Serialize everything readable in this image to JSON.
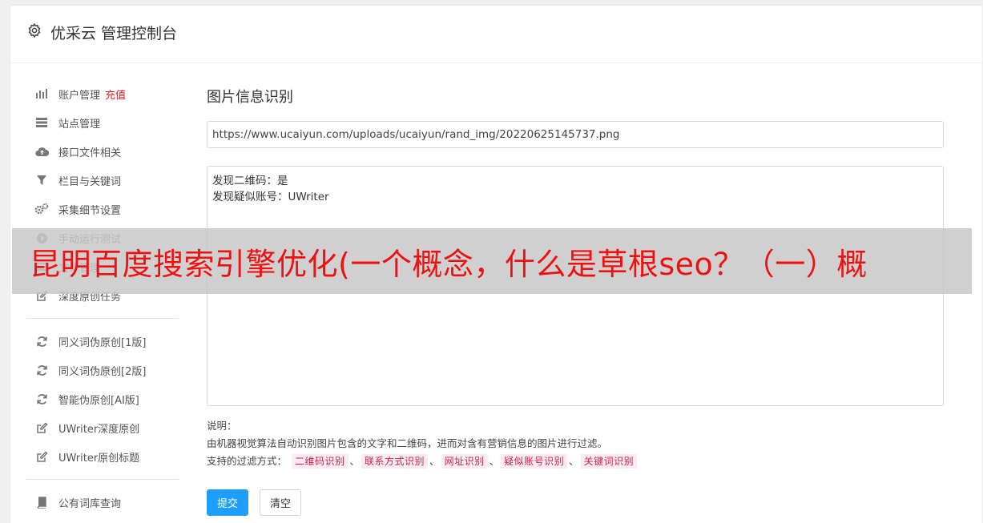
{
  "header": {
    "title": "优采云 管理控制台",
    "icon": "gear-icon"
  },
  "sidebar": {
    "group1": [
      {
        "label": "账户管理",
        "badge": "充值",
        "icon": "bar-chart-icon"
      },
      {
        "label": "站点管理",
        "icon": "server-icon"
      },
      {
        "label": "接口文件相关",
        "icon": "cloud-upload-icon"
      },
      {
        "label": "栏目与关键词",
        "icon": "filter-icon"
      },
      {
        "label": "采集细节设置",
        "icon": "gears-icon"
      },
      {
        "label": "手动运行测试",
        "icon": "play-icon"
      },
      {
        "label": "文章管理",
        "icon": "list-icon"
      },
      {
        "label": "深度原创任务",
        "icon": "edit-icon"
      }
    ],
    "group2": [
      {
        "label": "同义词伪原创[1版]",
        "icon": "refresh-icon"
      },
      {
        "label": "同义词伪原创[2版]",
        "icon": "refresh-icon"
      },
      {
        "label": "智能伪原创[AI版]",
        "icon": "refresh-icon"
      },
      {
        "label": "UWriter深度原创",
        "icon": "edit-icon"
      },
      {
        "label": "UWriter原创标题",
        "icon": "edit-icon"
      }
    ],
    "group3": [
      {
        "label": "公有词库查询",
        "icon": "book-icon"
      }
    ]
  },
  "main": {
    "title": "图片信息识别",
    "url_value": "https://www.ucaiyun.com/uploads/ucaiyun/rand_img/20220625145737.png",
    "result_lines": [
      "发现二维码：是",
      "发现疑似账号：UWriter"
    ],
    "desc_label": "说明：",
    "desc_text": "由机器视觉算法自动识别图片包含的文字和二维码，进而对含有营销信息的图片进行过滤。",
    "filter_label": "支持的过滤方式：",
    "filters": [
      "二维码识别",
      "联系方式识别",
      "网址识别",
      "疑似账号识别",
      "关键词识别"
    ],
    "separator": "、",
    "submit_label": "提交",
    "clear_label": "清空"
  },
  "overlay_text": "昆明百度搜索引擎优化(一个概念，什么是草根seo？（一）概",
  "colors": {
    "primary": "#1e9fff",
    "badge": "#e02020",
    "tag_bg": "#fbeaf0",
    "tag_text": "#c7254e",
    "overlay_text": "#ee1111"
  }
}
